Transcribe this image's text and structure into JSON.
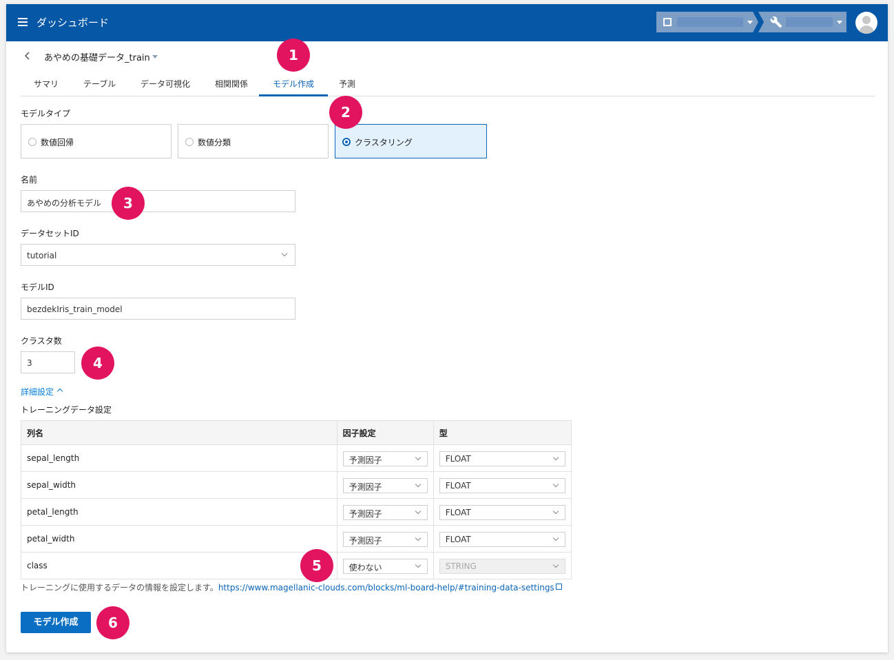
{
  "header": {
    "app_title": "ダッシュボード",
    "colors": {
      "primary": "#0658a6",
      "accent": "#0a64b8",
      "marker": "#e3145f"
    }
  },
  "dataset": {
    "title": "あやめの基礎データ_train"
  },
  "tabs": [
    {
      "label": "サマリ"
    },
    {
      "label": "テーブル"
    },
    {
      "label": "データ可視化"
    },
    {
      "label": "相関関係"
    },
    {
      "label": "モデル作成",
      "active": true
    },
    {
      "label": "予測"
    }
  ],
  "form": {
    "model_type_label": "モデルタイプ",
    "model_types": [
      {
        "label": "数値回帰",
        "selected": false
      },
      {
        "label": "数値分類",
        "selected": false
      },
      {
        "label": "クラスタリング",
        "selected": true
      }
    ],
    "name_label": "名前",
    "name_value": "あやめの分析モデル",
    "dataset_id_label": "データセットID",
    "dataset_id_value": "tutorial",
    "model_id_label": "モデルID",
    "model_id_value": "bezdekIris_train_model",
    "cluster_count_label": "クラスタ数",
    "cluster_count_value": "3",
    "detail_link": "詳細設定",
    "training_label": "トレーニングデータ設定"
  },
  "table": {
    "headers": [
      "列名",
      "因子設定",
      "型"
    ],
    "rows": [
      {
        "name": "sepal_length",
        "factor": "予測因子",
        "type": "FLOAT",
        "type_disabled": false
      },
      {
        "name": "sepal_width",
        "factor": "予測因子",
        "type": "FLOAT",
        "type_disabled": false
      },
      {
        "name": "petal_length",
        "factor": "予測因子",
        "type": "FLOAT",
        "type_disabled": false
      },
      {
        "name": "petal_width",
        "factor": "予測因子",
        "type": "FLOAT",
        "type_disabled": false
      },
      {
        "name": "class",
        "factor": "使わない",
        "type": "STRING",
        "type_disabled": true
      }
    ]
  },
  "help": {
    "text": "トレーニングに使用するデータの情報を設定します。",
    "link": "https://www.magellanic-clouds.com/blocks/ml-board-help/#training-data-settings"
  },
  "create_button": "モデル作成",
  "markers": [
    "1",
    "2",
    "3",
    "4",
    "5",
    "6"
  ]
}
